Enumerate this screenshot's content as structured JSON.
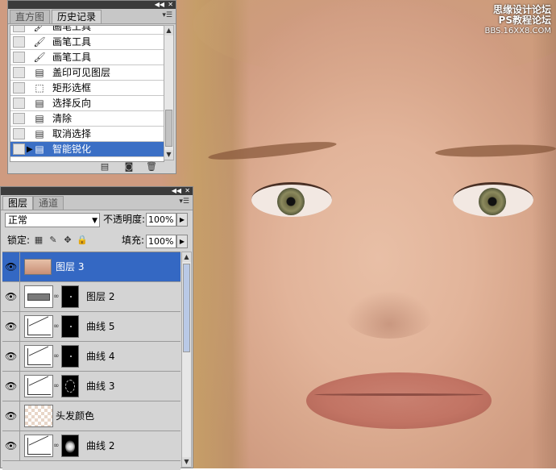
{
  "watermark": {
    "line1": "思缘设计论坛",
    "line2": "PS教程论坛",
    "line3": "BBS.16XX8.COM"
  },
  "history_panel": {
    "tabs": [
      {
        "label": "直方图",
        "active": false
      },
      {
        "label": "历史记录",
        "active": true
      }
    ],
    "items": [
      {
        "label": "画笔工具",
        "icon": "brush-icon",
        "selected": false
      },
      {
        "label": "画笔工具",
        "icon": "brush-icon",
        "selected": false
      },
      {
        "label": "画笔工具",
        "icon": "brush-icon",
        "selected": false
      },
      {
        "label": "盖印可见图层",
        "icon": "document-icon",
        "selected": false
      },
      {
        "label": "矩形选框",
        "icon": "marquee-icon",
        "selected": false
      },
      {
        "label": "选择反向",
        "icon": "document-icon",
        "selected": false
      },
      {
        "label": "清除",
        "icon": "document-icon",
        "selected": false
      },
      {
        "label": "取消选择",
        "icon": "document-icon",
        "selected": false
      },
      {
        "label": "智能锐化",
        "icon": "document-icon",
        "selected": true
      }
    ],
    "footer_icons": [
      "new-document-from-state-icon",
      "new-snapshot-icon",
      "delete-state-icon"
    ]
  },
  "layers_panel": {
    "tabs": [
      {
        "label": "图层",
        "active": true
      },
      {
        "label": "通道",
        "active": false
      }
    ],
    "blend_mode": "正常",
    "opacity_label": "不透明度:",
    "opacity_value": "100%",
    "lock_label": "锁定:",
    "fill_label": "填充:",
    "fill_value": "100%",
    "lock_icons": [
      "lock-transparent-icon",
      "lock-image-icon",
      "lock-position-icon",
      "lock-all-icon"
    ],
    "layers": [
      {
        "name": "图层 3",
        "thumb": "photo",
        "mask": null,
        "selected": true
      },
      {
        "name": "图层 2",
        "thumb": "gray",
        "mask": "dot",
        "selected": false
      },
      {
        "name": "曲线 5",
        "thumb": "curve",
        "mask": "dot",
        "selected": false
      },
      {
        "name": "曲线 4",
        "thumb": "curve",
        "mask": "dot",
        "selected": false
      },
      {
        "name": "曲线 3",
        "thumb": "curve",
        "mask": "ring",
        "selected": false
      },
      {
        "name": "头发颜色",
        "thumb": "check",
        "mask": null,
        "selected": false
      },
      {
        "name": "曲线 2",
        "thumb": "curve",
        "mask": "glow",
        "selected": false
      }
    ]
  },
  "colors": {
    "selection": "#3468c3",
    "panel_bg": "#d4d4d4"
  }
}
